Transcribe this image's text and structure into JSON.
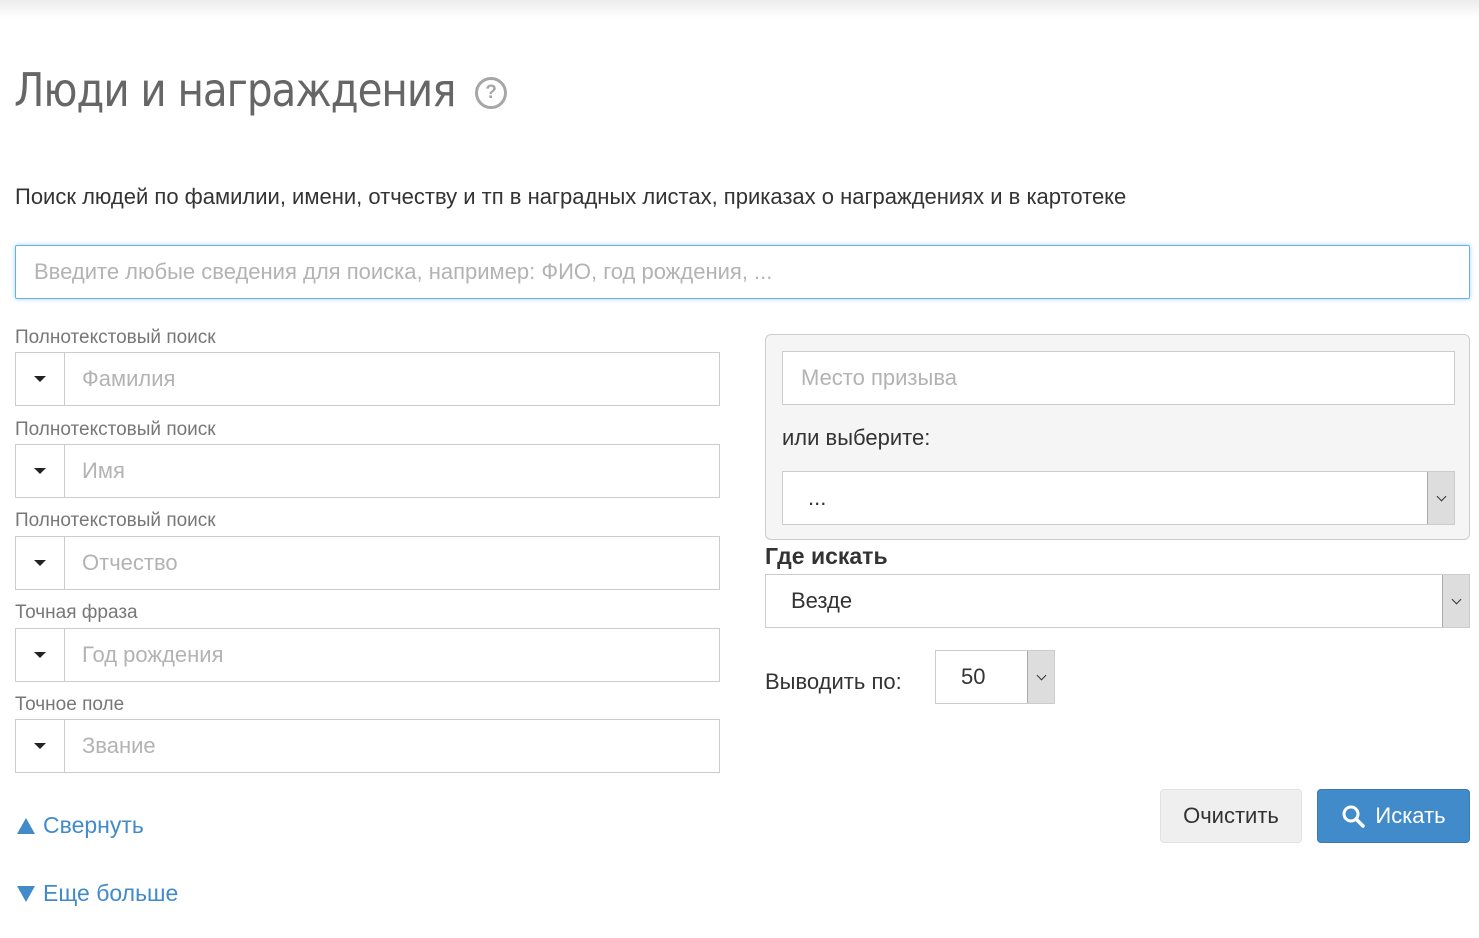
{
  "page": {
    "title": "Люди и награждения",
    "help_glyph": "?",
    "description": "Поиск людей по фамилии, имени, отчеству и тп в наградных листах, приказах о награждениях и в картотеке"
  },
  "main_search": {
    "placeholder": "Введите любые сведения для поиска, например: ФИО, год рождения, ..."
  },
  "fields": [
    {
      "mode": "Полнотекстовый поиск",
      "placeholder": "Фамилия"
    },
    {
      "mode": "Полнотекстовый поиск",
      "placeholder": "Имя"
    },
    {
      "mode": "Полнотекстовый поиск",
      "placeholder": "Отчество"
    },
    {
      "mode": "Точная фраза",
      "placeholder": "Год рождения"
    },
    {
      "mode": "Точное поле",
      "placeholder": "Звание"
    }
  ],
  "conscription": {
    "placeholder": "Место призыва",
    "or_label": "или выберите:",
    "selected": "..."
  },
  "where": {
    "label": "Где искать",
    "selected": "Везде"
  },
  "per_page": {
    "label": "Выводить по:",
    "selected": "50"
  },
  "actions": {
    "clear_label": "Очистить",
    "search_label": "Искать"
  },
  "links": {
    "collapse": "Свернуть",
    "more": "Еще больше"
  },
  "colors": {
    "accent": "#428bca",
    "focus_border": "#66afe9",
    "title": "#666666"
  },
  "icons": {
    "help": "question-circle-icon",
    "search": "magnifier-icon",
    "collapse": "triangle-up-icon",
    "more": "triangle-down-icon"
  }
}
